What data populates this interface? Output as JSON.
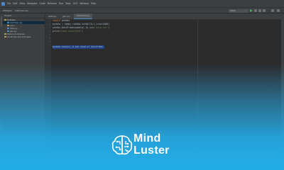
{
  "window": {
    "menu_items": [
      "File",
      "Edit",
      "View",
      "Navigate",
      "Code",
      "Refactor",
      "Run",
      "Tools",
      "VCS",
      "Window",
      "Help"
    ],
    "breadcrumb": [
      "Datagen",
      "loadmain.py"
    ]
  },
  "toolbar": {
    "run_config": "main"
  },
  "project_panel": {
    "header": "Project",
    "items": [
      {
        "label": "Datagen",
        "type": "folder",
        "indent": 0
      },
      {
        "label": "loadmain.py",
        "type": "py",
        "indent": 1,
        "selected": true
      },
      {
        "label": "venv",
        "type": "folder",
        "indent": 1
      },
      {
        "label": "data.py",
        "type": "py",
        "indent": 1
      },
      {
        "label": "gen.py",
        "type": "py",
        "indent": 1
      },
      {
        "label": "External Libraries",
        "type": "folder",
        "indent": 0
      },
      {
        "label": "Scratches and Consoles",
        "type": "folder",
        "indent": 0
      }
    ]
  },
  "editor": {
    "tabs": [
      {
        "label": "data.py",
        "active": false
      },
      {
        "label": "gen.py",
        "active": false
      },
      {
        "label": "loadmain.py",
        "active": true
      }
    ],
    "line_numbers": [
      "1",
      "2",
      "3",
      "4",
      "5",
      "6",
      "7",
      "8"
    ],
    "code_lines": [
      {
        "parts": [
          {
            "t": "import ",
            "c": "kw"
          },
          {
            "t": "pandas",
            "c": ""
          }
        ]
      },
      {
        "parts": [
          {
            "t": "mydata = numpy.random.normal(0,1,size=1000)",
            "c": ""
          }
        ]
      },
      {
        "parts": [
          {
            "t": "pandas.DataFrame(mydata).to_csv(",
            "c": ""
          },
          {
            "t": "'data.csv'",
            "c": "str"
          },
          {
            "t": ")",
            "c": ""
          }
        ]
      },
      {
        "parts": [
          {
            "t": "print(",
            "c": ""
          },
          {
            "t": "'data generated'",
            "c": "str"
          },
          {
            "t": ")",
            "c": ""
          }
        ]
      },
      {
        "parts": [
          {
            "t": "",
            "c": ""
          }
        ]
      },
      {
        "parts": [
          {
            "t": "mydata.head(n) # see head of dataframe",
            "c": ""
          }
        ],
        "selected": true
      }
    ]
  },
  "watermark": {
    "line1": "Mind",
    "line2": "Luster",
    "brain_icon": "brain-circuit-icon"
  },
  "colors": {
    "accent": "#4a88c7",
    "gradient": "#22aee8",
    "selection": "#214283"
  }
}
